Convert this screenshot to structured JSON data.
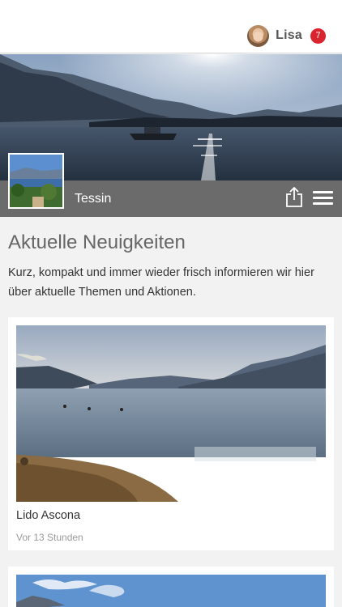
{
  "user": {
    "name": "Lisa",
    "notification_count": "7"
  },
  "region": {
    "name": "Tessin"
  },
  "section": {
    "title": "Aktuelle Neuigkeiten",
    "intro": "Kurz, kompakt und immer wieder frisch informieren wir hier über aktuelle Themen und Aktionen."
  },
  "news": [
    {
      "title": "Lido Ascona",
      "time": "Vor 13 Stunden"
    }
  ],
  "colors": {
    "badge": "#d9232d",
    "infobar": "#6b6b6b",
    "background": "#f2f2f2"
  },
  "icons": {
    "share": "share-icon",
    "menu": "hamburger-menu-icon"
  }
}
